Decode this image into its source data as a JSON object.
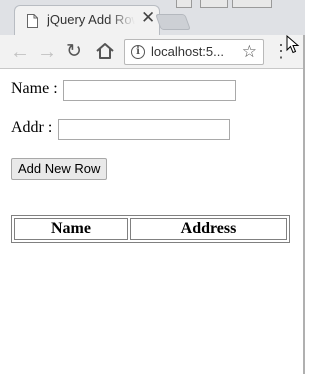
{
  "browser": {
    "tab_title": "jQuery Add Row",
    "tab_close": "✕",
    "url": "localhost:5...",
    "menu_glyph": "⋮",
    "star_glyph": "☆",
    "back_glyph": "←",
    "forward_glyph": "→",
    "reload_glyph": "↻",
    "info_glyph": "i"
  },
  "form": {
    "name_label": "Name :",
    "name_value": "",
    "addr_label": "Addr :",
    "addr_value": "",
    "add_button": "Add New Row"
  },
  "table": {
    "headers": [
      "Name",
      "Address"
    ],
    "rows": []
  },
  "colors": {
    "tabstrip": "#dfe1e5",
    "toolbar": "#f2f2f2",
    "border": "#808080"
  }
}
